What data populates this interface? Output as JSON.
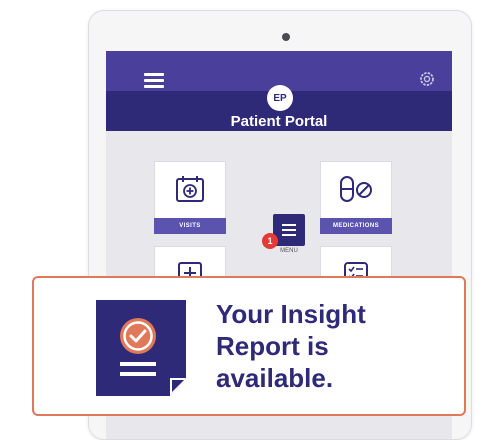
{
  "app": {
    "avatar_initials": "EP",
    "title": "Patient Portal"
  },
  "tiles": [
    {
      "label": "VISITS",
      "icon": "calendar-add-icon"
    },
    {
      "label": "MEDICATIONS",
      "icon": "pill-icon"
    },
    {
      "label": "",
      "icon": "add-box-icon"
    },
    {
      "label": "",
      "icon": "checklist-icon"
    }
  ],
  "menu": {
    "label": "MENU",
    "badge_count": "1",
    "icon": "menu-icon"
  },
  "notification": {
    "message_line1": "Your Insight",
    "message_line2": "Report is",
    "message_line3": "available.",
    "icon": "report-check-icon"
  },
  "colors": {
    "brand_primary": "#4a3f9a",
    "brand_dark": "#2f2a78",
    "accent": "#e0795a",
    "badge": "#e53935"
  }
}
